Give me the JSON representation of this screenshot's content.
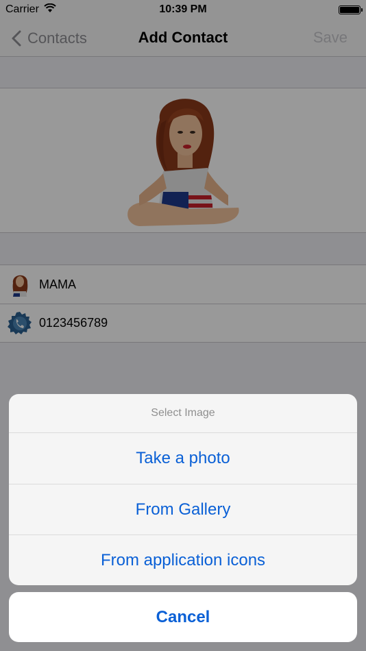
{
  "status_bar": {
    "carrier": "Carrier",
    "time": "10:39 PM"
  },
  "nav": {
    "back_label": "Contacts",
    "title": "Add Contact",
    "save_label": "Save"
  },
  "contact": {
    "name": "MAMA",
    "phone": "0123456789"
  },
  "action_sheet": {
    "title": "Select Image",
    "options": [
      {
        "label": "Take a photo"
      },
      {
        "label": "From Gallery"
      },
      {
        "label": "From application icons"
      }
    ],
    "cancel_label": "Cancel"
  },
  "colors": {
    "accent": "#0a60d6",
    "disabled": "#c7c7cc",
    "background": "#efeff4"
  },
  "icons": {
    "back": "chevron-left-icon",
    "wifi": "wifi-icon",
    "battery": "battery-icon",
    "avatar": "woman-avatar-icon",
    "phone": "phone-badge-icon"
  }
}
